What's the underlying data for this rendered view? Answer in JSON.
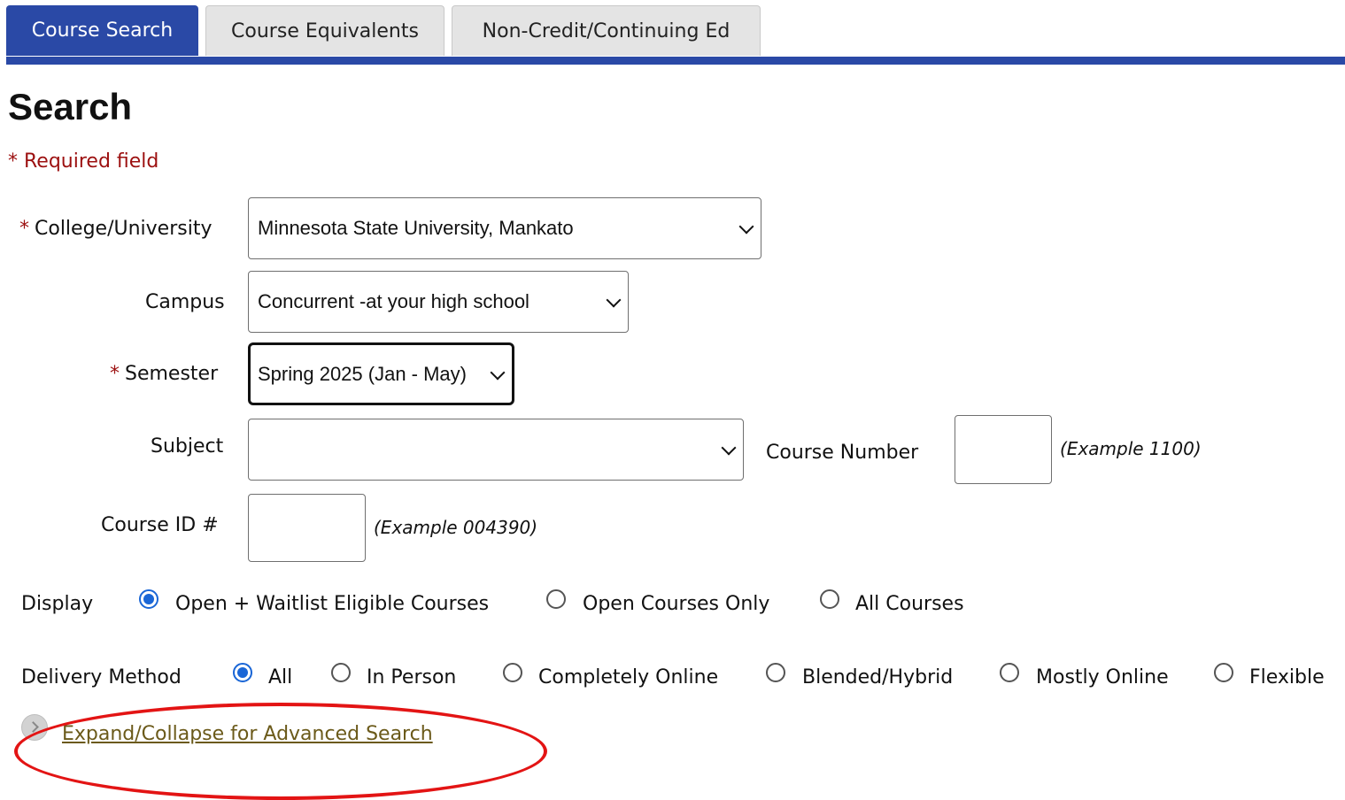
{
  "tabs": [
    {
      "label": "Course Search",
      "active": true
    },
    {
      "label": "Course Equivalents",
      "active": false
    },
    {
      "label": "Non-Credit/Continuing Ed",
      "active": false
    }
  ],
  "page": {
    "title": "Search",
    "required_note": "* Required field"
  },
  "form": {
    "college": {
      "label": "College/University",
      "required_marker": "*",
      "value": "Minnesota State University, Mankato"
    },
    "campus": {
      "label": "Campus",
      "value": "Concurrent -at your high school"
    },
    "semester": {
      "label": "Semester",
      "required_marker": "*",
      "value": "Spring 2025 (Jan - May)"
    },
    "subject": {
      "label": "Subject",
      "value": ""
    },
    "course_number": {
      "label": "Course Number",
      "value": "",
      "example": "(Example 1100)"
    },
    "course_id": {
      "label": "Course ID #",
      "value": "",
      "example": "(Example 004390)"
    },
    "display": {
      "label": "Display",
      "options": [
        "Open + Waitlist Eligible Courses",
        "Open Courses Only",
        "All Courses"
      ],
      "selected": "Open + Waitlist Eligible Courses"
    },
    "delivery": {
      "label": "Delivery Method",
      "options": [
        "All",
        "In Person",
        "Completely Online",
        "Blended/Hybrid",
        "Mostly Online",
        "Flexible"
      ],
      "selected": "All"
    },
    "advanced_link": "Expand/Collapse for Advanced Search"
  },
  "colors": {
    "tab_active": "#2a49a6",
    "required": "#9c1010",
    "radio_checked": "#1a66d6",
    "annotation": "#e31414",
    "link": "#6b5a1a"
  },
  "icons": [
    "chevron-down-icon",
    "expand-toggle-icon"
  ]
}
